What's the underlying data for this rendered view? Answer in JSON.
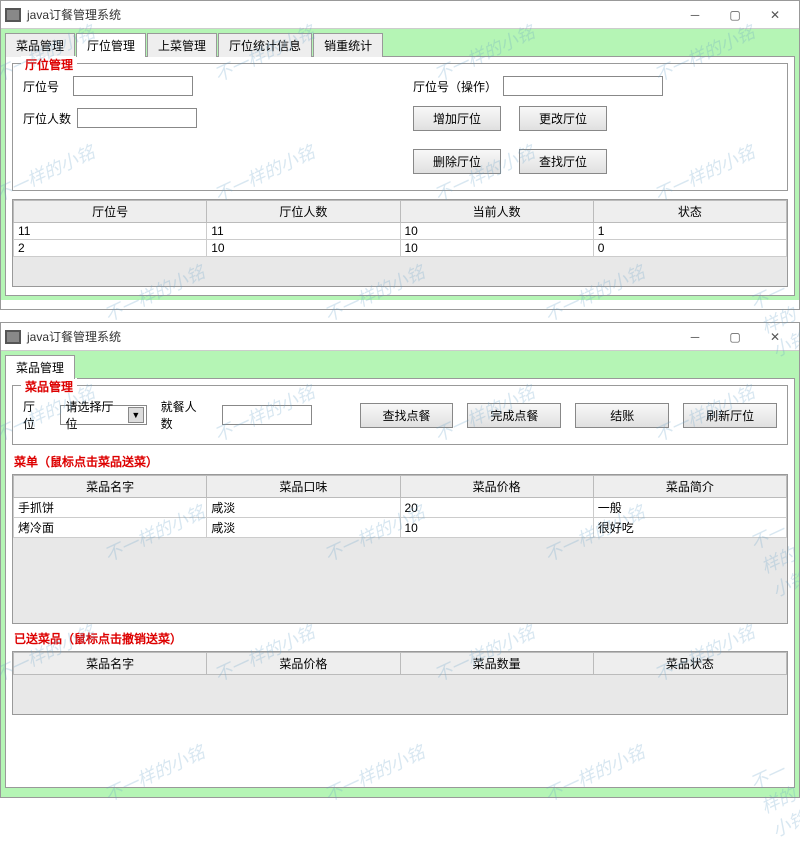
{
  "watermark_text": "不一样的小铭",
  "window1": {
    "title": "java订餐管理系统",
    "tabs": [
      "菜品管理",
      "厅位管理",
      "上菜管理",
      "厅位统计信息",
      "销重统计"
    ],
    "active_tab": 1,
    "panel_legend": "厅位管理",
    "labels": {
      "hall_no": "厅位号",
      "hall_people": "厅位人数",
      "hall_op": "厅位号（操作）"
    },
    "inputs": {
      "hall_no": "",
      "hall_people": "",
      "hall_op": ""
    },
    "buttons": {
      "add": "增加厅位",
      "modify": "更改厅位",
      "delete": "删除厅位",
      "search": "查找厅位"
    },
    "table": {
      "headers": [
        "厅位号",
        "厅位人数",
        "当前人数",
        "状态"
      ],
      "rows": [
        [
          "11",
          "11",
          "10",
          "1"
        ],
        [
          "2",
          "10",
          "10",
          "0"
        ]
      ]
    }
  },
  "window2": {
    "title": "java订餐管理系统",
    "tabs": [
      "菜品管理"
    ],
    "active_tab": 0,
    "panel_legend": "菜品管理",
    "labels": {
      "hall": "厅位",
      "diners": "就餐人数"
    },
    "select_placeholder": "请选择厅位",
    "inputs": {
      "diners": ""
    },
    "buttons": {
      "search": "查找点餐",
      "finish": "完成点餐",
      "checkout": "结账",
      "refresh": "刷新厅位"
    },
    "menu_label": "菜单（鼠标点击菜品送菜）",
    "menu_table": {
      "headers": [
        "菜品名字",
        "菜品口味",
        "菜品价格",
        "菜品简介"
      ],
      "rows": [
        [
          "手抓饼",
          "咸淡",
          "20",
          "一般"
        ],
        [
          "烤冷面",
          "咸淡",
          "10",
          "很好吃"
        ]
      ]
    },
    "selected_label": "已送菜品（鼠标点击撤销送菜）",
    "selected_table": {
      "headers": [
        "菜品名字",
        "菜品价格",
        "菜品数量",
        "菜品状态"
      ],
      "rows": []
    }
  }
}
